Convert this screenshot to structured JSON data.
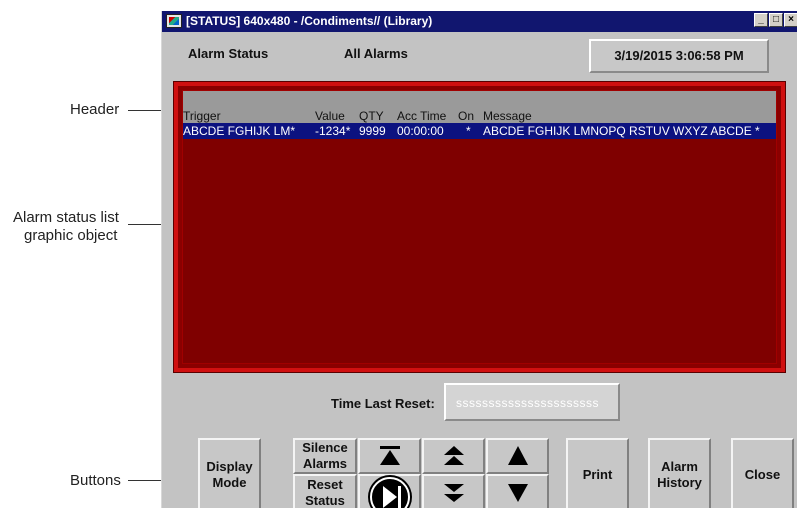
{
  "annotations": {
    "header": "Header",
    "list_line1": "Alarm status list",
    "list_line2": "graphic object",
    "buttons": "Buttons"
  },
  "window": {
    "title": "[STATUS] 640x480 - /Condiments// (Library)",
    "minimize": "_",
    "maximize": "□",
    "close": "×"
  },
  "header": {
    "alarm_status": "Alarm Status",
    "all_alarms": "All Alarms",
    "datetime": "3/19/2015 3:06:58 PM"
  },
  "alarm_list": {
    "columns": [
      "Trigger",
      "Value",
      "QTY",
      "Acc Time",
      "On",
      "Message"
    ],
    "rows": [
      {
        "trigger": "ABCDE FGHIJK LM*",
        "value": "-1234*",
        "qty": "9999",
        "acc_time": "00:00:00",
        "on": "*",
        "message": "ABCDE FGHIJK LMNOPQ RSTUV WXYZ ABCDE *"
      }
    ],
    "colors": {
      "frame": "#d01010",
      "background": "#7f0000",
      "header": "#9a9a9a",
      "selected_row": "#0c1280"
    }
  },
  "reset": {
    "label": "Time Last Reset:",
    "value": "ssssssssssssssssssssss"
  },
  "buttons": {
    "display_mode": "Display Mode",
    "silence_alarms": "Silence Alarms",
    "reset_status": "Reset Status",
    "print": "Print",
    "alarm_history": "Alarm History",
    "close": "Close",
    "icons": [
      "scroll-top-icon",
      "page-up-icon",
      "line-up-icon",
      "execute-icon",
      "page-down-icon",
      "line-down-icon"
    ]
  }
}
